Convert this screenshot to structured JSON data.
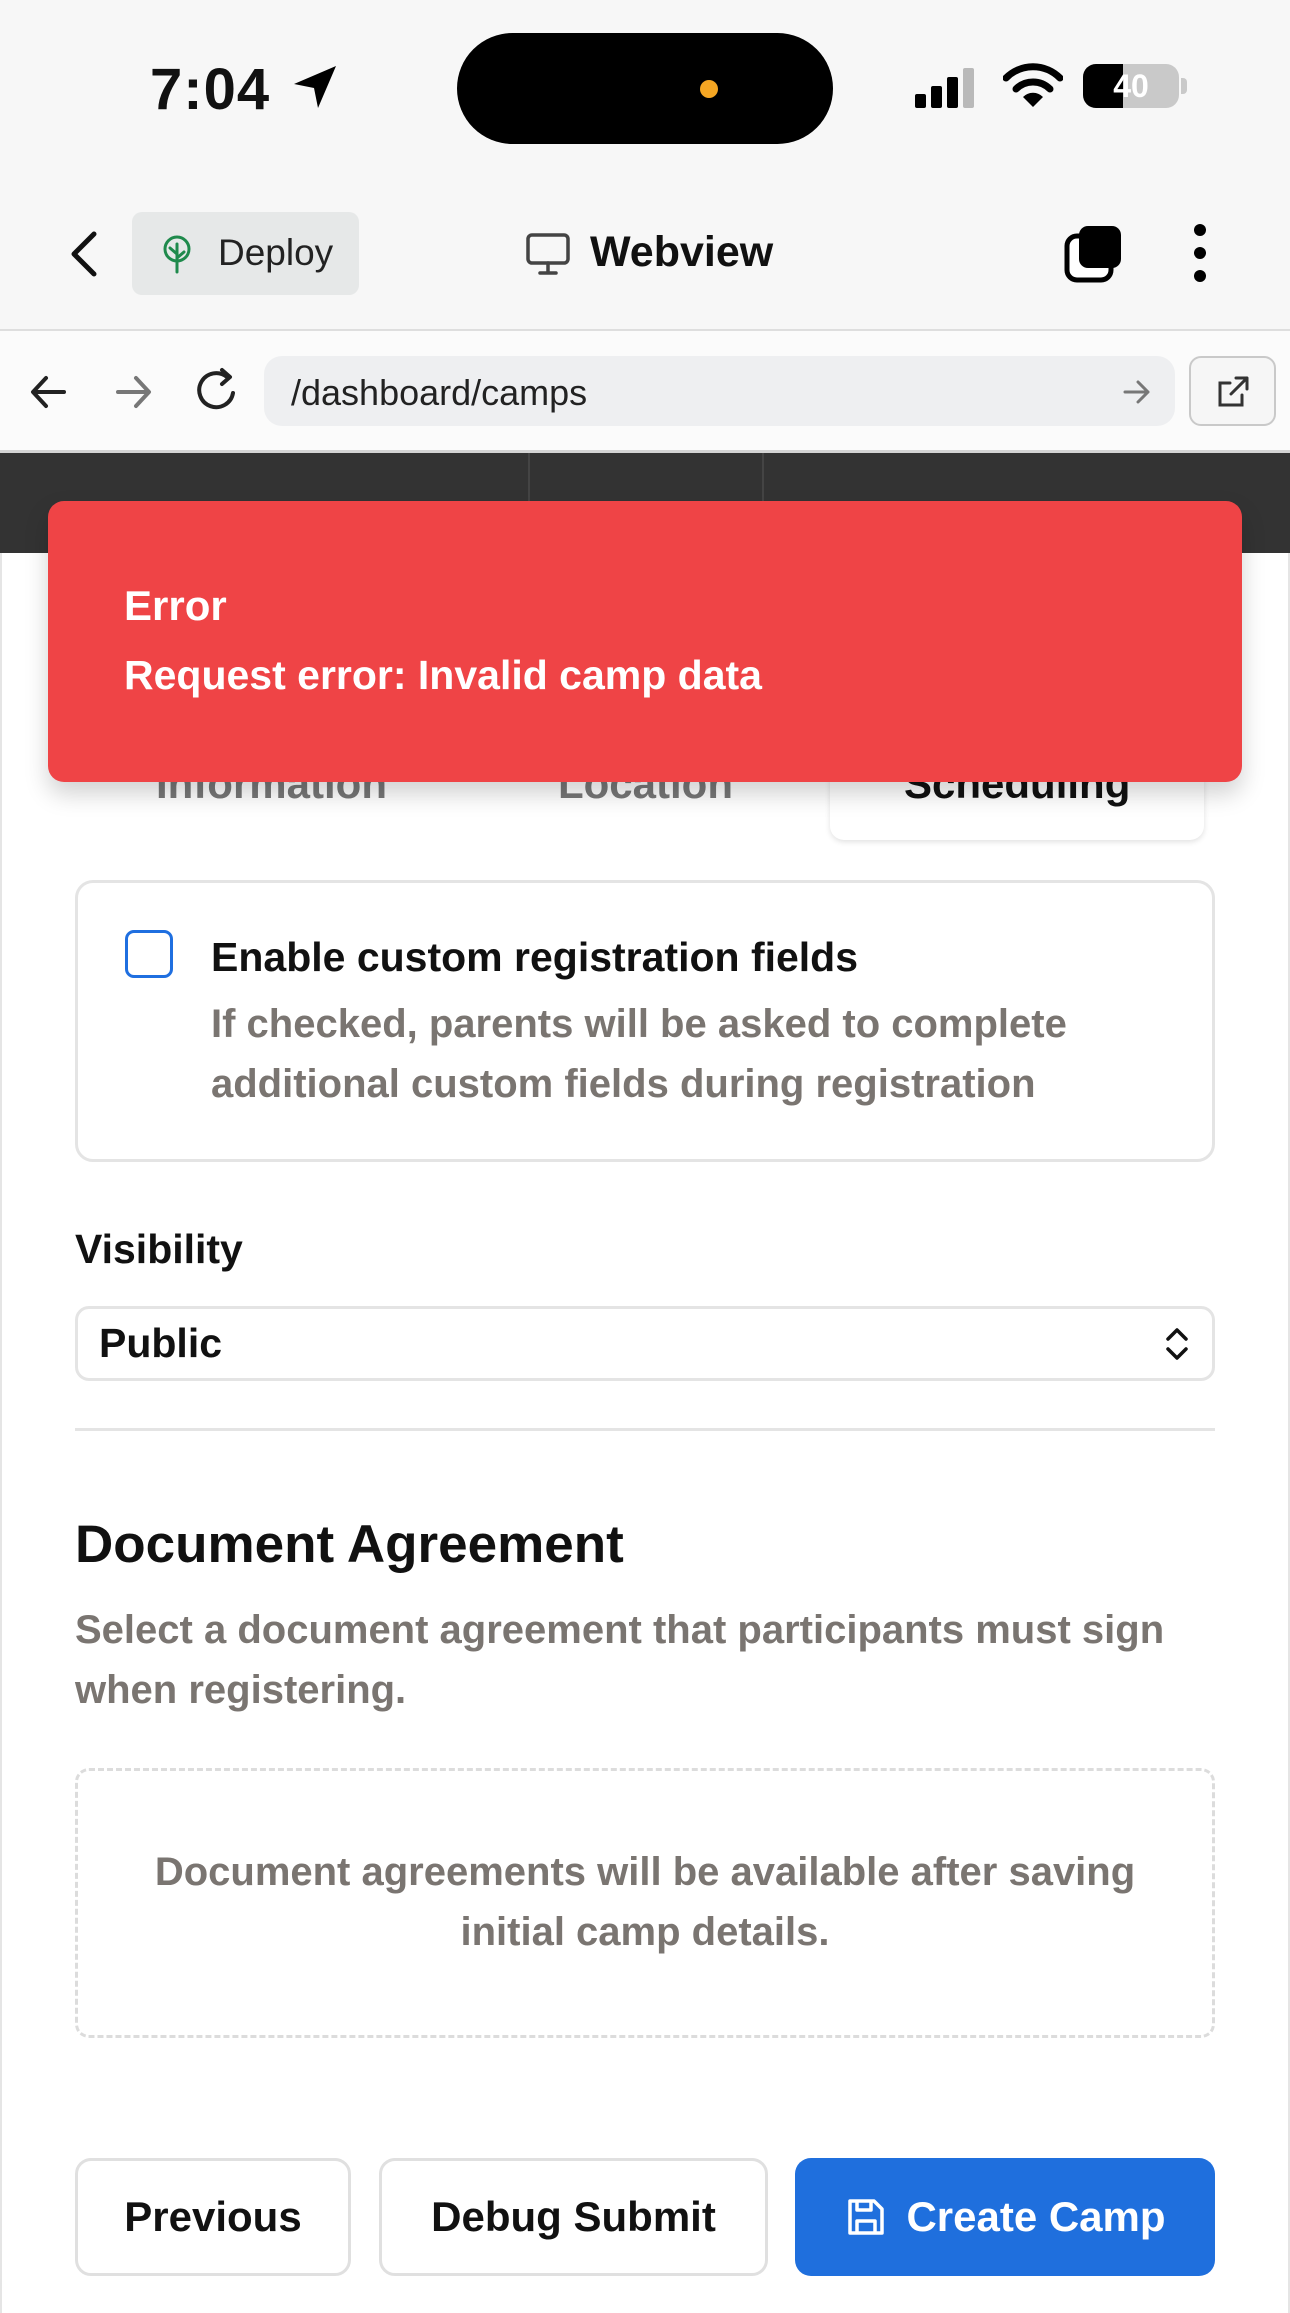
{
  "status_bar": {
    "time": "7:04",
    "battery": "40"
  },
  "app_toolbar": {
    "deploy_label": "Deploy",
    "webview_label": "Webview"
  },
  "url_bar": {
    "url": "/dashboard/camps"
  },
  "toast": {
    "title": "Error",
    "message": "Request error: Invalid camp data",
    "color": "#ef4446"
  },
  "tabs": [
    {
      "label": "Information"
    },
    {
      "label": "Location"
    },
    {
      "label": "Scheduling",
      "active": true
    }
  ],
  "custom_fields": {
    "title": "Enable custom registration fields",
    "description": "If checked, parents will be asked to complete additional custom fields during registration",
    "checked": false
  },
  "visibility": {
    "label": "Visibility",
    "value": "Public"
  },
  "document_agreement": {
    "title": "Document Agreement",
    "description": "Select a document agreement that participants must sign when registering.",
    "placeholder": "Document agreements will be available after saving initial camp details."
  },
  "buttons": {
    "previous": "Previous",
    "debug_submit": "Debug Submit",
    "create_camp": "Create Camp"
  },
  "colors": {
    "primary": "#1f6fdd",
    "checkbox_border": "#1f6fe0",
    "muted_text": "#7a7571"
  }
}
